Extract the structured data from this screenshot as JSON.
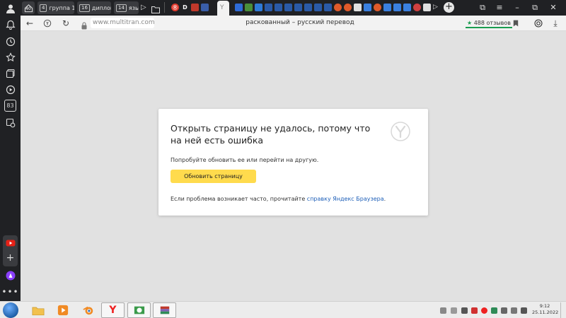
{
  "sidebar": {
    "badge_count": "83"
  },
  "tabs": {
    "badge_home": "40",
    "groups": [
      {
        "count": "4",
        "label": "группа 1"
      },
      {
        "count": "16",
        "label": "диплом"
      },
      {
        "count": "14",
        "label": "язык"
      }
    ],
    "pinned_letter": "D"
  },
  "addressbar": {
    "url": "www.multitran.com",
    "page_title": "раскованный – русский перевод",
    "reviews": "488 отзывов"
  },
  "error": {
    "title": "Открыть страницу не удалось, потому что на ней есть ошибка",
    "hint": "Попробуйте обновить ее или перейти на другую.",
    "reload_label": "Обновить страницу",
    "footer_text": "Если проблема возникает часто, прочитайте ",
    "footer_link": "справку Яндекс Браузера",
    "footer_end": "."
  },
  "taskbar": {
    "time": "9:12",
    "date": "25.11.2022"
  },
  "colors": {
    "accent_yellow": "#ffdb4d",
    "link_blue": "#1e5fb8",
    "reviews_green": "#1a9c4f",
    "chrome_dark": "#202124"
  }
}
